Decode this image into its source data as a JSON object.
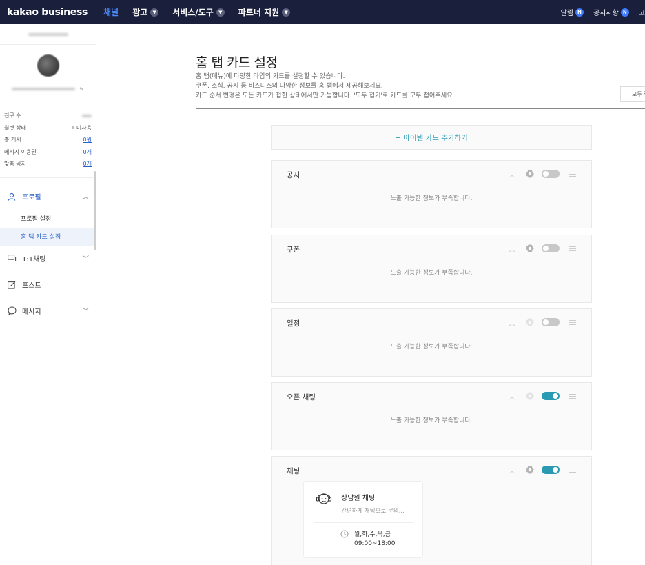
{
  "topbar": {
    "logo": "kakao business",
    "nav": [
      {
        "label": "채널",
        "active": true,
        "has_dropdown": false
      },
      {
        "label": "광고",
        "active": false,
        "has_dropdown": true
      },
      {
        "label": "서비스/도구",
        "active": false,
        "has_dropdown": true
      },
      {
        "label": "파트너 지원",
        "active": false,
        "has_dropdown": true
      }
    ],
    "right": [
      {
        "label": "알림",
        "badge": "N"
      },
      {
        "label": "공지사항",
        "badge": "N"
      },
      {
        "label": "고"
      }
    ]
  },
  "sidebar": {
    "stats": [
      {
        "label": "친구 수",
        "value": ""
      },
      {
        "label": "월렛 상태",
        "value": "미사용"
      },
      {
        "label": "총 캐시",
        "value": "0원"
      },
      {
        "label": "메시지 이용권",
        "value": "0개"
      },
      {
        "label": "맞춤 공지",
        "value": "0개"
      }
    ],
    "menu": {
      "profile": "프로필",
      "profile_settings": "프로필 설정",
      "home_tab_card": "홈 탭 카드 설정",
      "chat": "1:1채팅",
      "post": "포스트",
      "message": "메시지"
    }
  },
  "main": {
    "title": "홈 탭 카드 설정",
    "desc_lines": [
      "홈 탭(메뉴)에 다양한 타입의 카드를 설정할 수 있습니다.",
      "쿠폰, 소식, 공지 등 비즈니스의 다양한 정보를 홈 탭에서 제공해보세요.",
      "카드 순서 변경은 모든 카드가 접힌 상태에서만 가능합니다. '모두 접기'로 카드를 모두 접어주세요."
    ],
    "collapse_all": "모두 접기",
    "add_card": "+ 아이템 카드 추가하기",
    "empty_msg": "노출 가능한 정보가 부족합니다.",
    "cards": [
      {
        "title": "공지",
        "toggle": false,
        "gear_active": true
      },
      {
        "title": "쿠폰",
        "toggle": false,
        "gear_active": true
      },
      {
        "title": "일정",
        "toggle": false,
        "gear_active": false
      },
      {
        "title": "오픈 채팅",
        "toggle": true,
        "gear_active": false
      },
      {
        "title": "채팅",
        "toggle": true,
        "gear_active": true
      }
    ],
    "chat_card": {
      "title": "상담원 채팅",
      "subtitle": "간편하게 채팅으로 문의...",
      "days": "월,화,수,목,금",
      "hours": "09:00~18:00"
    }
  },
  "colors": {
    "topbar_bg": "#1a1f3c",
    "nav_active": "#4d8cff",
    "accent_teal": "#2a9ab2",
    "link_blue": "#2b62c8"
  }
}
